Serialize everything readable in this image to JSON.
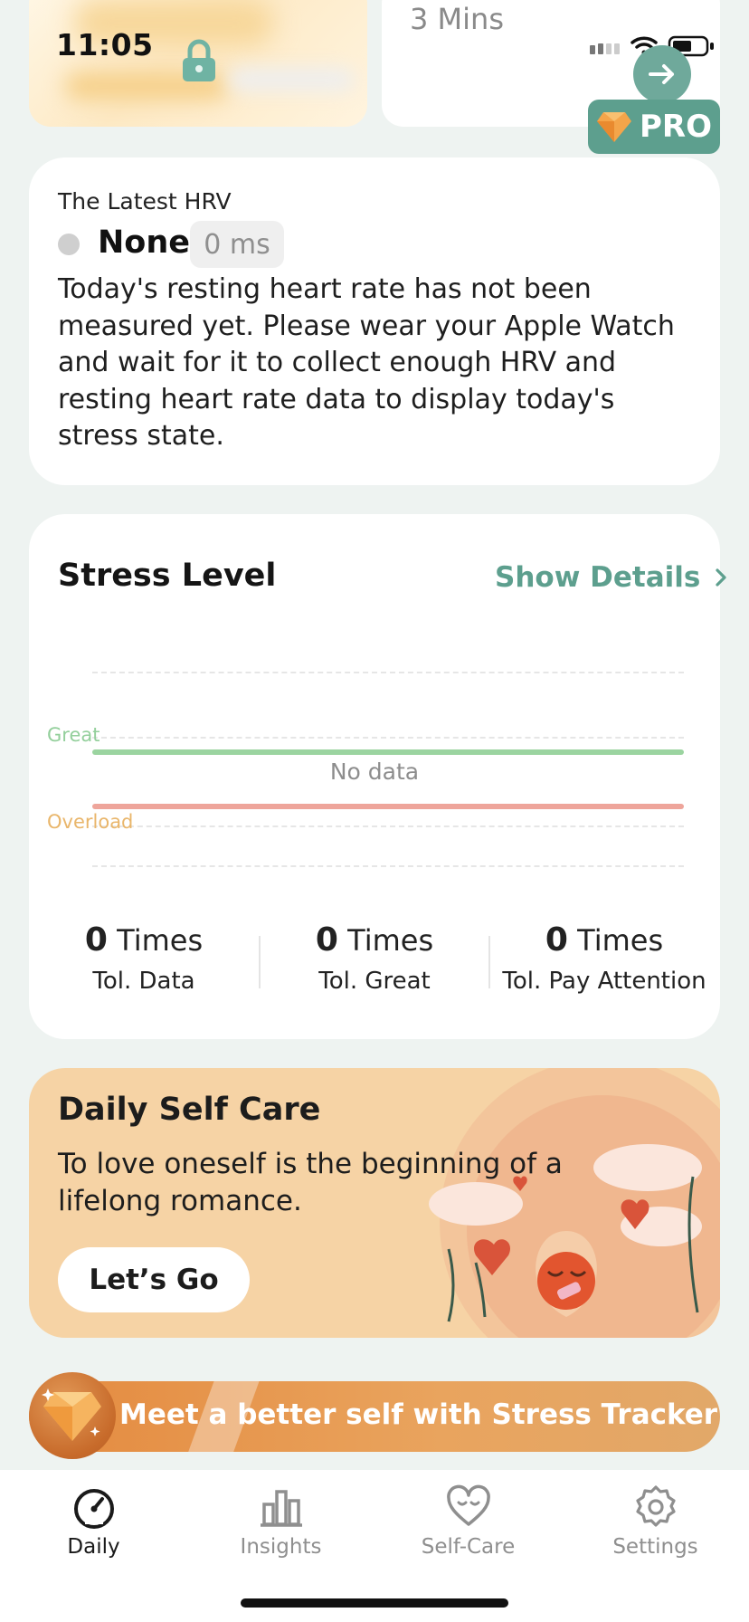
{
  "status_bar": {
    "time": "11:05"
  },
  "top_cards": {
    "right_value": "3 Mins"
  },
  "pro_badge": {
    "label": "PRO"
  },
  "hrv": {
    "title": "The Latest HRV",
    "status": "None",
    "value": "0 ms",
    "description": "Today's resting heart rate has not been measured yet. Please wear your Apple Watch and wait for it to collect enough HRV and resting heart rate data to display today's stress state."
  },
  "stress": {
    "title": "Stress Level",
    "details_link": "Show Details",
    "great_label": "Great",
    "overload_label": "Overload",
    "no_data": "No data",
    "stats": [
      {
        "count": "0",
        "unit": "Times",
        "label": "Tol. Data"
      },
      {
        "count": "0",
        "unit": "Times",
        "label": "Tol. Great"
      },
      {
        "count": "0",
        "unit": "Times",
        "label": "Tol. Pay Attention"
      }
    ]
  },
  "self_care": {
    "title": "Daily Self Care",
    "subtitle": "To love oneself is the beginning of a lifelong romance.",
    "button": "Let’s Go"
  },
  "promo": {
    "text": "Meet a better self with Stress Tracker"
  },
  "tabs": [
    {
      "label": "Daily",
      "icon": "gauge-icon",
      "active": true
    },
    {
      "label": "Insights",
      "icon": "bar-chart-icon",
      "active": false
    },
    {
      "label": "Self-Care",
      "icon": "heart-smile-icon",
      "active": false
    },
    {
      "label": "Settings",
      "icon": "gear-icon",
      "active": false
    }
  ],
  "colors": {
    "accent": "#5d9f8e",
    "great_line": "#9bd4a0",
    "overload_line": "#eea59b",
    "self_care_bg": "#f6d3a5",
    "promo_bg": "#e48a3f"
  }
}
